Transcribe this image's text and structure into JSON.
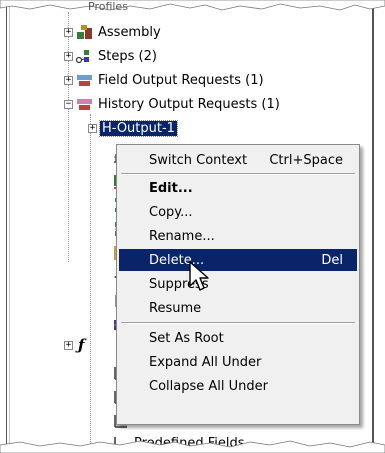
{
  "tree": {
    "partial_top_label": "Profiles",
    "items": [
      {
        "label": "Assembly",
        "expander": "+"
      },
      {
        "label": "Steps (2)",
        "expander": "+"
      },
      {
        "label": "Field Output Requests (1)",
        "expander": "+"
      },
      {
        "label": "History Output Requests (1)",
        "expander": "−"
      },
      {
        "label": "H-Output-1",
        "expander": "+"
      }
    ],
    "partial_bottom_label": "Predefined Fields"
  },
  "context_menu": {
    "items": [
      {
        "label": "Switch Context",
        "shortcut": "Ctrl+Space"
      },
      {
        "label": "Edit...",
        "shortcut": ""
      },
      {
        "label": "Copy...",
        "shortcut": ""
      },
      {
        "label": "Rename...",
        "shortcut": ""
      },
      {
        "label": "Delete...",
        "shortcut": "Del"
      },
      {
        "label": "Suppress",
        "shortcut": ""
      },
      {
        "label": "Resume",
        "shortcut": ""
      },
      {
        "label": "Set As Root",
        "shortcut": ""
      },
      {
        "label": "Expand All Under",
        "shortcut": ""
      },
      {
        "label": "Collapse All Under",
        "shortcut": ""
      }
    ],
    "highlighted_item": "Delete..."
  },
  "colors": {
    "selection": "#0a246a",
    "menu_background": "#f0f0f0"
  }
}
